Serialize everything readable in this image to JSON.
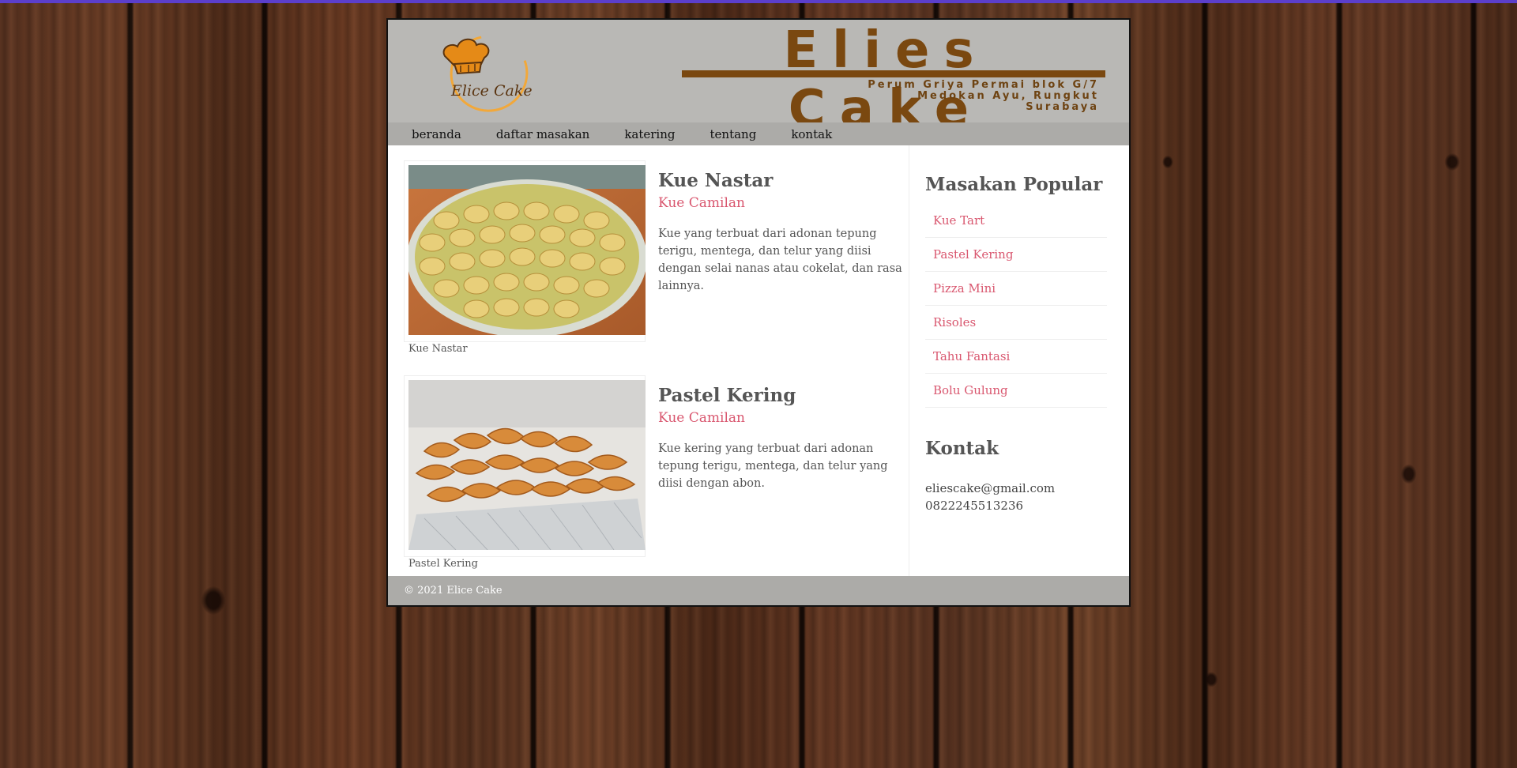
{
  "header": {
    "logo_text": "Elice Cake",
    "brand_title": "Elies Cake",
    "address_line1": "Perum Griya Permai blok G/7",
    "address_line2": "Medokan Ayu, Rungkut",
    "address_line3": "Surabaya"
  },
  "nav": {
    "items": [
      {
        "label": "beranda"
      },
      {
        "label": "daftar masakan"
      },
      {
        "label": "katering"
      },
      {
        "label": "tentang"
      },
      {
        "label": "kontak"
      }
    ]
  },
  "posts": [
    {
      "title": "Kue Nastar",
      "subtitle": "Kue Camilan",
      "text": "Kue yang terbuat dari adonan tepung terigu, mentega, dan telur yang diisi dengan selai nanas atau cokelat, dan rasa lainnya.",
      "caption": "Kue Nastar"
    },
    {
      "title": "Pastel Kering",
      "subtitle": "Kue Camilan",
      "text": "Kue kering yang terbuat dari adonan tepung terigu, mentega, dan telur yang diisi dengan abon.",
      "caption": "Pastel Kering"
    }
  ],
  "sidebar": {
    "popular_heading": "Masakan Popular",
    "popular_items": [
      {
        "label": "Kue Tart"
      },
      {
        "label": "Pastel Kering"
      },
      {
        "label": "Pizza Mini"
      },
      {
        "label": "Risoles"
      },
      {
        "label": "Tahu Fantasi"
      },
      {
        "label": "Bolu Gulung"
      }
    ],
    "contact_heading": "Kontak",
    "email": "eliescake@gmail.com",
    "phone": "0822245513236"
  },
  "footer": {
    "text": "© 2021 Elice Cake"
  },
  "colors": {
    "accent": "#d9576f",
    "brand": "#7a4810",
    "header_bg": "#b9b8b5",
    "nav_bg": "#acaba8"
  }
}
